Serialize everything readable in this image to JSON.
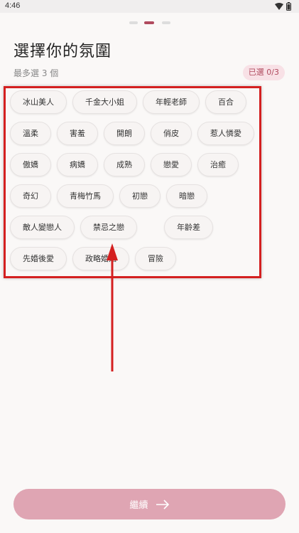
{
  "status_bar": {
    "time": "4:46"
  },
  "pager": {
    "total": 3,
    "current": 2
  },
  "header": {
    "title": "選擇你的氛圍",
    "subtitle": "最多選 3 個",
    "counter": "已選 0/3"
  },
  "tags": [
    "冰山美人",
    "千金大小姐",
    "年輕老師",
    "百合",
    "溫柔",
    "害羞",
    "開朗",
    "俏皮",
    "惹人憐愛",
    "傲嬌",
    "病嬌",
    "成熟",
    "戀愛",
    "治癒",
    "奇幻",
    "青梅竹馬",
    "初戀",
    "暗戀",
    "敵人變戀人",
    "禁忌之戀",
    "年齡差",
    "先婚後愛",
    "政略婚姻",
    "冒險"
  ],
  "footer": {
    "continue_label": "繼續"
  },
  "colors": {
    "accent": "#b04a5e",
    "button_disabled": "#dfa5b3",
    "annotation": "#d42020"
  }
}
